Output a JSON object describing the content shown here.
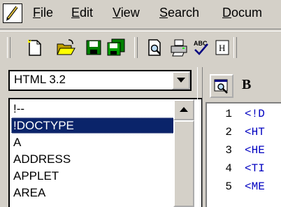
{
  "menubar": {
    "items": [
      {
        "label": "File"
      },
      {
        "label": "Edit"
      },
      {
        "label": "View"
      },
      {
        "label": "Search"
      },
      {
        "label": "Docum"
      }
    ]
  },
  "toolbar": {
    "buttons": [
      "new-file",
      "open-folder",
      "save",
      "save-all",
      "print-preview",
      "print",
      "spell-check",
      "html-tag"
    ]
  },
  "tag_panel": {
    "language": "HTML 3.2",
    "tags": [
      "!--",
      "!DOCTYPE",
      "A",
      "ADDRESS",
      "APPLET",
      "AREA"
    ],
    "selected_index": 1
  },
  "editor": {
    "bold_label": "B",
    "lines": [
      {
        "num": "1",
        "code": "<!D"
      },
      {
        "num": "2",
        "code": "<HT"
      },
      {
        "num": "3",
        "code": "<HE"
      },
      {
        "num": "4",
        "code": "<TI"
      },
      {
        "num": "5",
        "code": "<ME"
      }
    ]
  },
  "colors": {
    "selection": "#0a246a",
    "code_text": "#0000c0",
    "chrome": "#d4d0c8"
  }
}
